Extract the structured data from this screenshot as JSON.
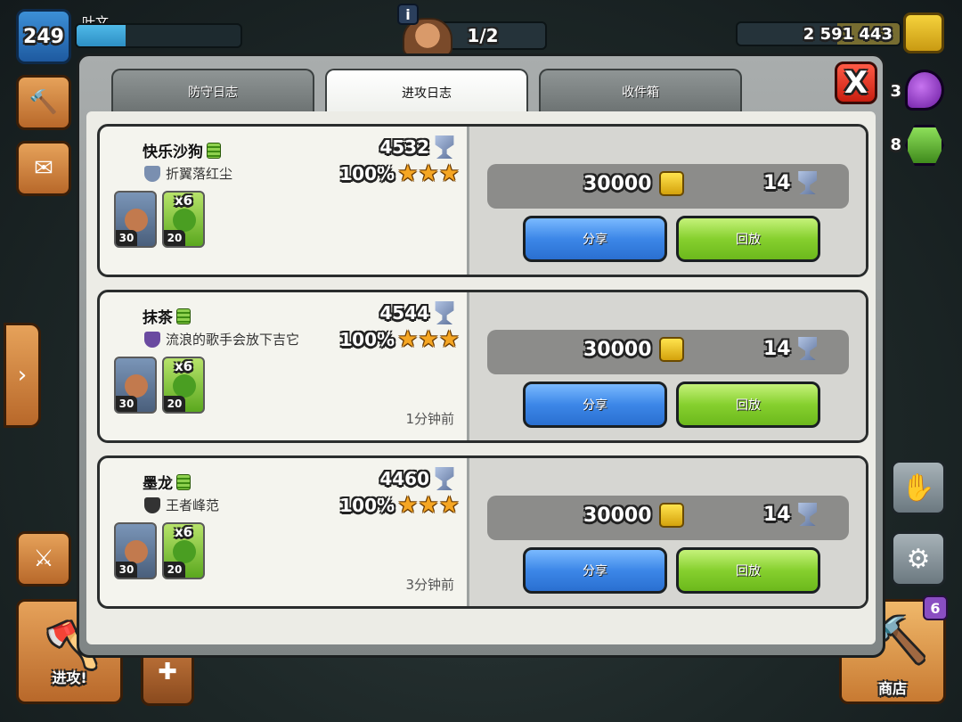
{
  "hud": {
    "level": "249",
    "player_name": "叶文",
    "xp_fraction": 0.3,
    "builders": "1/2",
    "gold_amount": "2 591 443",
    "elixir_partial": "3",
    "gem_partial": "8",
    "info_glyph": "i"
  },
  "left_buttons": {
    "attack_label": "进攻!"
  },
  "right_buttons": {
    "shop_label": "商店",
    "shop_badge": "6"
  },
  "tabs": [
    {
      "label": "防守日志",
      "active": false
    },
    {
      "label": "进攻日志",
      "active": true
    },
    {
      "label": "收件箱",
      "active": false
    }
  ],
  "close_label": "X",
  "entries": [
    {
      "player": "快乐沙狗",
      "clan": "折翼落红尘",
      "clan_color": "#7a8fb0",
      "trophies": "4532",
      "percent": "100%",
      "stars": 3,
      "troops": [
        {
          "level": "30",
          "count": ""
        },
        {
          "level": "20",
          "count": "x6"
        }
      ],
      "time_ago": "",
      "loot_gold": "30000",
      "loot_trophies": "14",
      "share_label": "分享",
      "replay_label": "回放"
    },
    {
      "player": "抹茶",
      "clan": "流浪的歌手会放下吉它",
      "clan_color": "#6a4aa0",
      "trophies": "4544",
      "percent": "100%",
      "stars": 3,
      "troops": [
        {
          "level": "30",
          "count": ""
        },
        {
          "level": "20",
          "count": "x6"
        }
      ],
      "time_ago": "1分钟前",
      "loot_gold": "30000",
      "loot_trophies": "14",
      "share_label": "分享",
      "replay_label": "回放"
    },
    {
      "player": "墨龙",
      "clan": "王者峰范",
      "clan_color": "#333333",
      "trophies": "4460",
      "percent": "100%",
      "stars": 3,
      "troops": [
        {
          "level": "30",
          "count": ""
        },
        {
          "level": "20",
          "count": "x6"
        }
      ],
      "time_ago": "3分钟前",
      "loot_gold": "30000",
      "loot_trophies": "14",
      "share_label": "分享",
      "replay_label": "回放"
    }
  ],
  "colors": {
    "gold": "#f5d23c",
    "star": "#f5a623",
    "share": "#3c87e8",
    "replay": "#86d02e",
    "close": "#e02a18"
  }
}
